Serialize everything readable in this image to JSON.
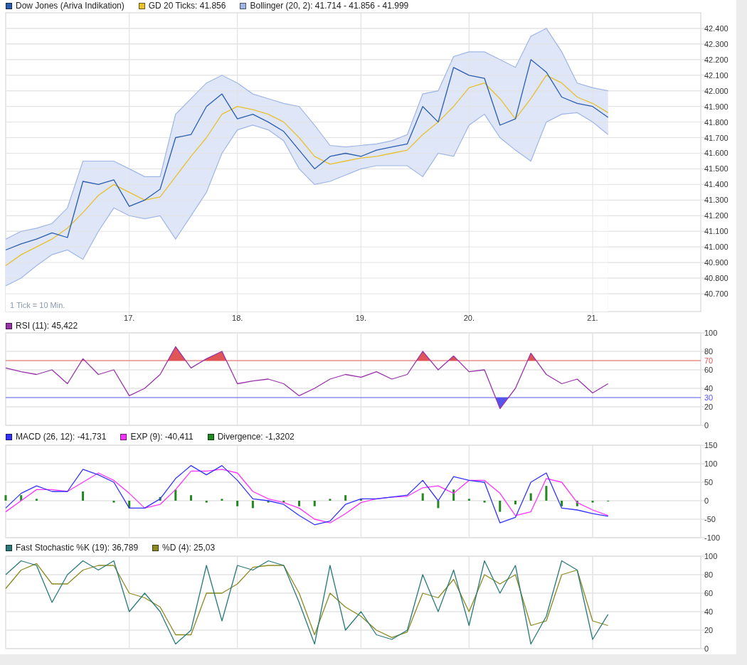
{
  "panels": [
    {
      "kind": "price",
      "note": "1 Tick = 10 Min.",
      "chart_data": {
        "type": "line",
        "grid": true,
        "ylim": [
          40586,
          42500
        ],
        "categories": [
          null,
          null,
          null,
          null,
          null,
          null,
          null,
          null,
          "17.",
          null,
          null,
          null,
          null,
          null,
          null,
          "18.",
          null,
          null,
          null,
          null,
          null,
          null,
          null,
          "19.",
          null,
          null,
          null,
          null,
          null,
          null,
          "20.",
          null,
          null,
          null,
          null,
          null,
          null,
          null,
          "21.",
          null
        ],
        "yticks": [
          {
            "value": 42400,
            "label": "42.400"
          },
          {
            "value": 42300,
            "label": "42.300"
          },
          {
            "value": 42200,
            "label": "42.200"
          },
          {
            "value": 42100,
            "label": "42.100"
          },
          {
            "value": 42000,
            "label": "42.000"
          },
          {
            "value": 41900,
            "label": "41.900"
          },
          {
            "value": 41800,
            "label": "41.800"
          },
          {
            "value": 41700,
            "label": "41.700"
          },
          {
            "value": 41600,
            "label": "41.600"
          },
          {
            "value": 41500,
            "label": "41.500"
          },
          {
            "value": 41400,
            "label": "41.400"
          },
          {
            "value": 41300,
            "label": "41.300"
          },
          {
            "value": 41200,
            "label": "41.200"
          },
          {
            "value": 41100,
            "label": "41.100"
          },
          {
            "value": 41000,
            "label": "41.000"
          },
          {
            "value": 40900,
            "label": "40.900"
          },
          {
            "value": 40800,
            "label": "40.800"
          },
          {
            "value": 40700,
            "label": "40.700"
          }
        ],
        "series": [
          {
            "name": "Dow Jones (Ariva Indikation)",
            "color": "#2a5db0",
            "values": [
              40980,
              41020,
              41050,
              41090,
              41060,
              41420,
              41400,
              41430,
              41260,
              41300,
              41370,
              41700,
              41720,
              41900,
              41980,
              41820,
              41850,
              41800,
              41740,
              41620,
              41500,
              41580,
              41600,
              41580,
              41620,
              41640,
              41660,
              41900,
              41800,
              42150,
              42100,
              42080,
              41780,
              41820,
              42200,
              42120,
              41960,
              41920,
              41900,
              41830
            ]
          },
          {
            "name": "GD 20 Ticks: 41.856",
            "color": "#e8c030",
            "values": [
              40880,
              40950,
              41000,
              41050,
              41120,
              41220,
              41330,
              41400,
              41350,
              41300,
              41320,
              41450,
              41580,
              41700,
              41850,
              41900,
              41880,
              41850,
              41800,
              41700,
              41580,
              41530,
              41550,
              41570,
              41580,
              41600,
              41620,
              41720,
              41800,
              41900,
              42020,
              42050,
              41950,
              41820,
              41950,
              42100,
              42050,
              41960,
              41920,
              41860
            ]
          },
          {
            "name": "Bollinger (20, 2): 41.714 - 41.856 - 41.999",
            "type": "area",
            "color": "#9fb6e6",
            "values": [
              41050,
              41100,
              41120,
              41150,
              41250,
              41550,
              41550,
              41550,
              41500,
              41450,
              41450,
              41850,
              41950,
              42050,
              42100,
              42050,
              41980,
              41950,
              41920,
              41900,
              41780,
              41650,
              41640,
              41650,
              41660,
              41680,
              41720,
              41980,
              42000,
              42220,
              42250,
              42250,
              42200,
              42150,
              42350,
              42400,
              42250,
              42050,
              42020,
              42000
            ]
          },
          {
            "type": "area",
            "color": "#9fb6e6",
            "values": [
              40750,
              40800,
              40880,
              40950,
              40980,
              40920,
              41100,
              41250,
              41200,
              41180,
              41200,
              41050,
              41200,
              41350,
              41600,
              41750,
              41780,
              41750,
              41680,
              41500,
              41400,
              41420,
              41460,
              41500,
              41520,
              41520,
              41520,
              41450,
              41600,
              41580,
              41780,
              41850,
              41700,
              41620,
              41550,
              41800,
              41850,
              41860,
              41800,
              41720
            ]
          }
        ]
      }
    },
    {
      "kind": "rsi",
      "chart_data": {
        "type": "line",
        "grid": true,
        "ylim": [
          0,
          100
        ],
        "yticks": [
          0,
          20,
          40,
          60,
          80,
          100
        ],
        "ref_lines": [
          {
            "axis": "y",
            "value": 70,
            "label": "70",
            "color": "#e05555"
          },
          {
            "axis": "y",
            "value": 30,
            "label": "30",
            "color": "#5555ee"
          }
        ],
        "series": [
          {
            "name": "RSI (11): 45,422",
            "color": "#9933aa",
            "values": [
              62,
              58,
              55,
              60,
              45,
              72,
              55,
              60,
              32,
              40,
              55,
              85,
              62,
              72,
              80,
              45,
              48,
              50,
              45,
              32,
              40,
              50,
              55,
              52,
              58,
              50,
              55,
              80,
              60,
              75,
              58,
              60,
              18,
              40,
              78,
              55,
              45,
              50,
              35,
              45
            ]
          }
        ]
      }
    },
    {
      "kind": "macd",
      "chart_data": {
        "type": "line",
        "grid": true,
        "ylim": [
          -100,
          150
        ],
        "yticks": [
          -100,
          -50,
          0,
          50,
          100,
          150
        ],
        "series": [
          {
            "name": "MACD (26, 12): -41,731",
            "color": "#3333ff",
            "values": [
              -20,
              20,
              40,
              25,
              25,
              85,
              70,
              50,
              -20,
              -20,
              5,
              60,
              95,
              70,
              95,
              55,
              5,
              0,
              -10,
              -40,
              -65,
              -55,
              -10,
              5,
              5,
              10,
              15,
              55,
              0,
              65,
              55,
              50,
              -60,
              -45,
              50,
              75,
              -20,
              -25,
              -35,
              -42
            ]
          },
          {
            "name": "EXP (9): -40,411",
            "color": "#ff33ff",
            "values": [
              -30,
              0,
              30,
              30,
              25,
              50,
              75,
              55,
              20,
              -20,
              -10,
              30,
              80,
              80,
              85,
              75,
              25,
              5,
              -5,
              -20,
              -50,
              -60,
              -35,
              -5,
              5,
              10,
              12,
              35,
              40,
              20,
              55,
              55,
              20,
              -40,
              -30,
              60,
              50,
              -5,
              -25,
              -40
            ]
          },
          {
            "name": "Divergence: -1,3202",
            "type": "bar",
            "color": "#228822",
            "values": [
              15,
              15,
              5,
              0,
              0,
              25,
              0,
              -5,
              -20,
              0,
              10,
              30,
              15,
              -5,
              5,
              -15,
              -20,
              -5,
              -5,
              -15,
              -15,
              5,
              15,
              5,
              0,
              0,
              0,
              20,
              -20,
              30,
              5,
              -5,
              -30,
              -10,
              20,
              40,
              -15,
              -15,
              -5,
              -2
            ]
          }
        ]
      }
    },
    {
      "kind": "stoch",
      "chart_data": {
        "type": "line",
        "grid": true,
        "ylim": [
          0,
          100
        ],
        "yticks": [
          0,
          20,
          40,
          60,
          80,
          100
        ],
        "series": [
          {
            "name": "Fast Stochastic %K (19): 36,789",
            "color": "#2a7a7a",
            "values": [
              80,
              95,
              90,
              50,
              80,
              95,
              85,
              95,
              40,
              60,
              40,
              5,
              20,
              90,
              30,
              90,
              85,
              95,
              90,
              50,
              5,
              90,
              20,
              40,
              15,
              10,
              20,
              80,
              40,
              85,
              25,
              95,
              60,
              90,
              5,
              35,
              95,
              85,
              10,
              37
            ]
          },
          {
            "name": "%D (4): 25,03",
            "color": "#8a8a20",
            "values": [
              65,
              85,
              92,
              70,
              70,
              85,
              90,
              90,
              60,
              55,
              45,
              15,
              15,
              60,
              60,
              70,
              88,
              90,
              90,
              60,
              15,
              60,
              45,
              35,
              20,
              12,
              18,
              60,
              55,
              75,
              40,
              80,
              70,
              80,
              25,
              30,
              80,
              85,
              30,
              25
            ]
          }
        ]
      }
    }
  ]
}
